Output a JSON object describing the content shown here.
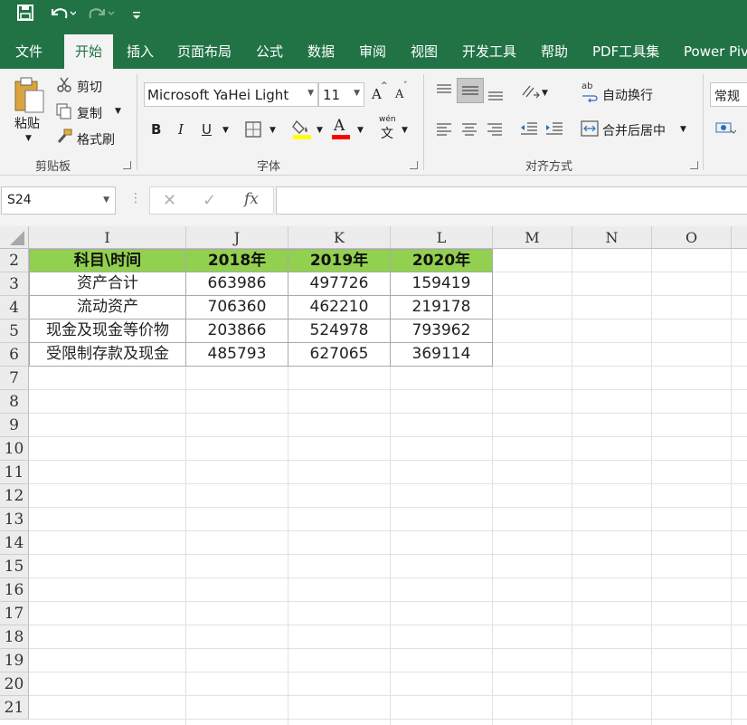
{
  "quick_access": {
    "save_icon": "save-icon",
    "undo_icon": "undo-icon",
    "redo_icon": "redo-icon",
    "customize_icon": "customize-icon"
  },
  "tabs": [
    "文件",
    "开始",
    "插入",
    "页面布局",
    "公式",
    "数据",
    "审阅",
    "视图",
    "开发工具",
    "帮助",
    "PDF工具集",
    "Power Piv"
  ],
  "active_tab": "开始",
  "clipboard": {
    "paste": "粘贴",
    "cut": "剪切",
    "copy": "复制",
    "format_painter": "格式刷",
    "group_label": "剪贴板"
  },
  "font": {
    "name": "Microsoft YaHei Light",
    "size": "11",
    "bold": "B",
    "italic": "I",
    "underline": "U",
    "grow": "A",
    "shrink": "A",
    "font_color_letter": "A",
    "phonetic": "wén",
    "phonetic_char": "文",
    "group_label": "字体",
    "highlight_color": "#ffff00",
    "font_color": "#ff0000"
  },
  "alignment": {
    "wrap_text": "自动换行",
    "merge_center": "合并后居中",
    "wrap_glyph": "ab",
    "group_label": "对齐方式"
  },
  "number": {
    "format": "常规"
  },
  "formula_bar": {
    "name_box": "S24",
    "fx": "fx",
    "formula": ""
  },
  "columns": [
    "I",
    "J",
    "K",
    "L",
    "M",
    "N",
    "O"
  ],
  "rows": [
    "2",
    "3",
    "4",
    "5",
    "6",
    "7",
    "8",
    "9",
    "10",
    "11",
    "12",
    "13",
    "14",
    "15",
    "16",
    "17",
    "18",
    "19",
    "20",
    "21"
  ],
  "table": {
    "headers": [
      "科目\\时间",
      "2018年",
      "2019年",
      "2020年"
    ],
    "rows": [
      [
        "资产合计",
        "663986",
        "497726",
        "159419"
      ],
      [
        "流动资产",
        "706360",
        "462210",
        "219178"
      ],
      [
        "现金及现金等价物",
        "203866",
        "524978",
        "793962"
      ],
      [
        "受限制存款及现金",
        "485793",
        "627065",
        "369114"
      ]
    ],
    "header_color": "#92d050"
  },
  "colors": {
    "brand": "#217346",
    "ribbon": "#f3f3f3"
  }
}
